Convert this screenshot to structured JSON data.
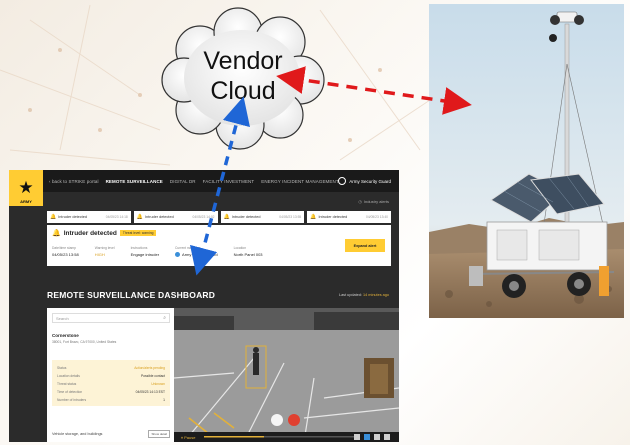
{
  "cloud": {
    "line1": "Vendor",
    "line2": "Cloud"
  },
  "dashboard": {
    "logo": {
      "star": "★",
      "text": "ARMY"
    },
    "nav": {
      "back": "‹  back to STRIKE portal",
      "items": [
        "REMOTE SURVEILLANCE",
        "DIGITAL DR",
        "FACILITY INVESTMENT",
        "ENERGY INCIDENT MANAGEMENT"
      ],
      "user": "Army Security Guard"
    },
    "alerts_link": "Industry alerts",
    "alert_chips": [
      {
        "label": "Intruder detected",
        "time": "04/05/23 14:18"
      },
      {
        "label": "Intruder detected",
        "time": "04/05/23 14:02"
      },
      {
        "label": "Intruder detected",
        "time": "04/05/23 13:55"
      },
      {
        "label": "Intruder detected",
        "time": "04/05/23 13:40"
      }
    ],
    "incident": {
      "title": "Intruder detected",
      "badge": "Threat level: warning",
      "fields": [
        {
          "label": "Date/time stamp",
          "value": "04/05/23 13:58"
        },
        {
          "label": "Warning level",
          "value": "HIGH"
        },
        {
          "label": "Instructions",
          "value": "Engage intruder"
        },
        {
          "label": "Current manager",
          "value": "Army security guard"
        },
        {
          "label": "Location",
          "value": "North Panel 003"
        }
      ],
      "expand": "Expand alert"
    },
    "section_title": "REMOTE SURVEILLANCE DASHBOARD",
    "updated_label": "Last updated:",
    "updated_value": "14 minutes ago",
    "panel": {
      "search_placeholder": "Search",
      "site_name": "Cornerstone",
      "site_address": "38001, Fort Bravo, CA 97000, United States",
      "status": [
        {
          "k": "Status",
          "v": "Action/alerts pending"
        },
        {
          "k": "Location details",
          "v": "Possible contact"
        },
        {
          "k": "Threat status",
          "v": "Unknown"
        },
        {
          "k": "Time of detection",
          "v": "04/05/23 14:13 EST"
        },
        {
          "k": "Number of intruders",
          "v": "1"
        }
      ],
      "bottom_label": "Vehicle storage, and buildings",
      "bottom_button": "Show detail"
    },
    "camera": {
      "pause": "⏸ Pause"
    }
  },
  "colors": {
    "accent": "#ffcc33",
    "cloud_arrow": "#1f66d6",
    "vendor_arrow": "#e0191b",
    "dash_bg": "#2b2b2b"
  }
}
